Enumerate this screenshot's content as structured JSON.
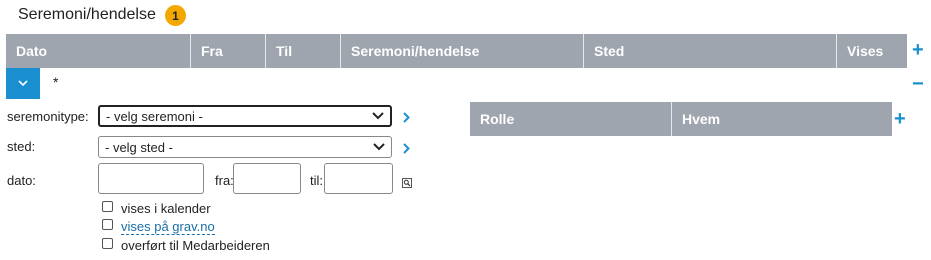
{
  "section": {
    "title": "Seremoni/hendelse",
    "badge_count": "1"
  },
  "table": {
    "headers": [
      "Dato",
      "Fra",
      "Til",
      "Seremoni/hendelse",
      "Sted",
      "Vises"
    ],
    "add_label": "+",
    "collapse_label": "−",
    "row_marker": "*"
  },
  "form": {
    "seremonitype": {
      "label": "seremonitype:",
      "value": "- velg seremoni -"
    },
    "sted": {
      "label": "sted:",
      "value": "- velg sted -"
    },
    "dato": {
      "label": "dato:",
      "fra_label": "fra:",
      "til_label": "til:"
    },
    "checkboxes": [
      {
        "label": "vises i kalender",
        "checked": false,
        "link": false
      },
      {
        "label": "vises på grav.no",
        "checked": false,
        "link": true
      },
      {
        "label": "overført til Medarbeideren",
        "checked": false,
        "link": false
      }
    ]
  },
  "roles_table": {
    "headers": [
      "Rolle",
      "Hvem"
    ],
    "add_label": "+"
  },
  "colors": {
    "accent": "#1a8fd0",
    "header_bg": "#9ea5ae",
    "badge": "#f2a800"
  }
}
